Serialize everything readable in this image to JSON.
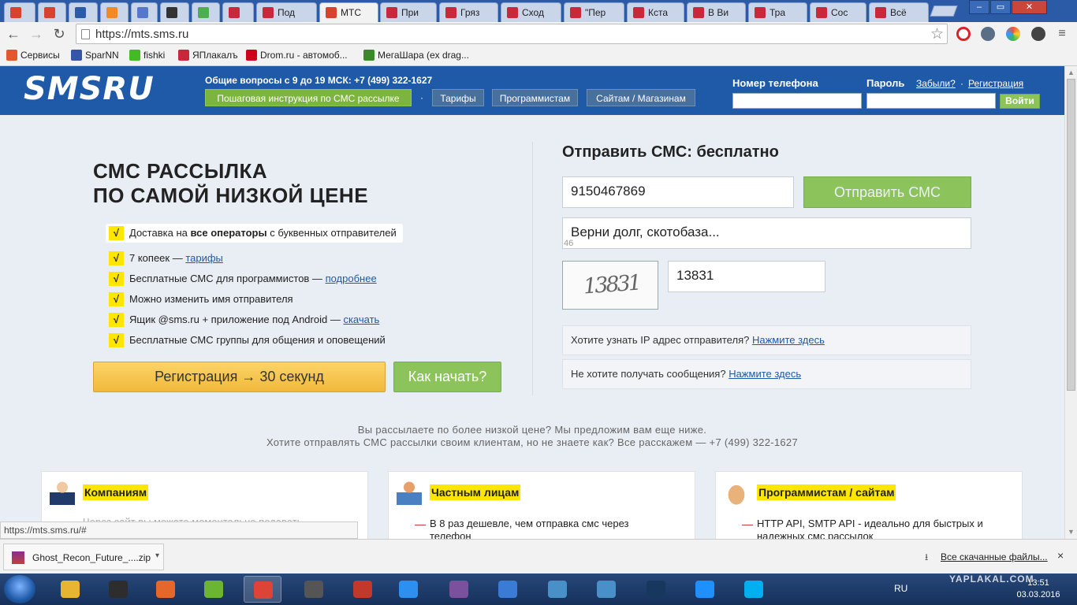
{
  "browser": {
    "tabs": [
      {
        "label": "",
        "color": "#d8432f"
      },
      {
        "label": "",
        "color": "#d8432f"
      },
      {
        "label": "",
        "color": "#2b5aa6"
      },
      {
        "label": "",
        "color": "#f08a24"
      },
      {
        "label": "",
        "color": "#5577cc"
      },
      {
        "label": "",
        "color": "#333333"
      },
      {
        "label": "",
        "color": "#4caf50"
      },
      {
        "label": "",
        "color": "#c9283a"
      },
      {
        "label": "Под",
        "color": "#c9283a"
      },
      {
        "label": "МТС",
        "color": "#d8432f",
        "active": true
      },
      {
        "label": "При",
        "color": "#c9283a"
      },
      {
        "label": "Гряз",
        "color": "#c9283a"
      },
      {
        "label": "Сход",
        "color": "#c9283a"
      },
      {
        "label": "\"Пер",
        "color": "#c9283a"
      },
      {
        "label": "Кста",
        "color": "#c9283a"
      },
      {
        "label": "В Ви",
        "color": "#c9283a"
      },
      {
        "label": "Тра",
        "color": "#c9283a"
      },
      {
        "label": "Сос",
        "color": "#c9283a"
      },
      {
        "label": "Всё",
        "color": "#c9283a"
      }
    ],
    "url": "https://mts.sms.ru",
    "bookmarks": [
      {
        "label": "Сервисы",
        "color": "#e4572e"
      },
      {
        "label": "SparNN",
        "color": "#3355aa"
      },
      {
        "label": "fishki",
        "color": "#44bb22"
      },
      {
        "label": "ЯПлакалъ",
        "color": "#c9283a"
      },
      {
        "label": "Drom.ru - автомоб...",
        "color": "#d0021b"
      },
      {
        "label": "МегаШара (ex drag...",
        "color": "#3b8a2a"
      }
    ],
    "status_url": "https://mts.sms.ru/#"
  },
  "header": {
    "logo": "SMSRU",
    "support": "Общие вопросы с 9 до 19 МСК: +7 (499) 322-1627",
    "nav": [
      "Пошаговая инструкция по СМС рассылке",
      "Тарифы",
      "Программистам",
      "Сайтам / Магазинам"
    ],
    "nav_sep": "·",
    "phone_label": "Номер телефона",
    "password_label": "Пароль",
    "forgot_link": "Забыли?",
    "link_sep": "·",
    "register_link": "Регистрация",
    "login_button": "Войти"
  },
  "hero": {
    "title_line1": "СМС РАССЫЛКА",
    "title_line2": "ПО САМОЙ НИЗКОЙ ЦЕНЕ",
    "check": "√",
    "features": [
      {
        "pre": "Доставка на ",
        "bold": "все операторы",
        "post": " с буквенных отправителей",
        "link": ""
      },
      {
        "pre": "7 копеек — ",
        "bold": "",
        "post": "",
        "link": "тарифы"
      },
      {
        "pre": "Бесплатные СМС для программистов — ",
        "bold": "",
        "post": "",
        "link": "подробнее"
      },
      {
        "pre": "Можно изменить имя отправителя",
        "bold": "",
        "post": "",
        "link": ""
      },
      {
        "pre": "Ящик @sms.ru + приложение под Android — ",
        "bold": "",
        "post": "",
        "link": "скачать"
      },
      {
        "pre": "Бесплатные СМС группы для общения и оповещений",
        "bold": "",
        "post": "",
        "link": ""
      }
    ],
    "register_button": "Регистрация → 30 секунд",
    "start_button": "Как начать?"
  },
  "send_form": {
    "title": "Отправить СМС: бесплатно",
    "phone_value": "9150467869",
    "send_button": "Отправить СМС",
    "message_value": "Верни долг, скотобаза...",
    "char_counter": "46",
    "captcha_image_text": "13831",
    "captcha_value": "13831",
    "ip_question": "Хотите узнать IP адрес отправителя?",
    "ip_link": "Нажмите здесь",
    "unsubscribe_question": "Не хотите получать сообщения?",
    "unsubscribe_link": "Нажмите здесь"
  },
  "promo": {
    "line1": "Вы рассылаете по более низкой цене? Мы предложим вам еще ниже.",
    "line2": "Хотите отправлять СМС рассылки своим клиентам, но не знаете как? Все расскажем — +7 (499) 322-1627"
  },
  "cards": [
    {
      "title": "Компаниям",
      "text": "",
      "faded": "Через сайт вы можете моментально подавать"
    },
    {
      "title": "Частным лицам",
      "text": "В 8 раз дешевле, чем отправка смс через телефон"
    },
    {
      "title": "Программистам / сайтам",
      "text": "HTTP API, SMTP API - идеально для быстрых и надежных смс рассылок"
    }
  ],
  "downloads": {
    "file": "Ghost_Recon_Future_....zip",
    "all_link": "Все скачанные файлы...",
    "close": "×"
  },
  "taskbar": {
    "lang": "RU",
    "time": "13:51",
    "date": "03.03.2016",
    "watermark": "YAPLAKAL.COM",
    "apps": [
      {
        "color": "#e8b530"
      },
      {
        "color": "#2d2d2d"
      },
      {
        "color": "#e5672a"
      },
      {
        "color": "#6bb532"
      },
      {
        "color": "#db4437",
        "active": true
      },
      {
        "color": "#555555"
      },
      {
        "color": "#c0392b"
      },
      {
        "color": "#2d8ff0"
      },
      {
        "color": "#7b519d"
      },
      {
        "color": "#3a7bd5"
      },
      {
        "color": "#4a90c8"
      },
      {
        "color": "#4a90c8"
      },
      {
        "color": "#17375e"
      },
      {
        "color": "#1e90ff"
      },
      {
        "color": "#00aff0"
      }
    ]
  }
}
